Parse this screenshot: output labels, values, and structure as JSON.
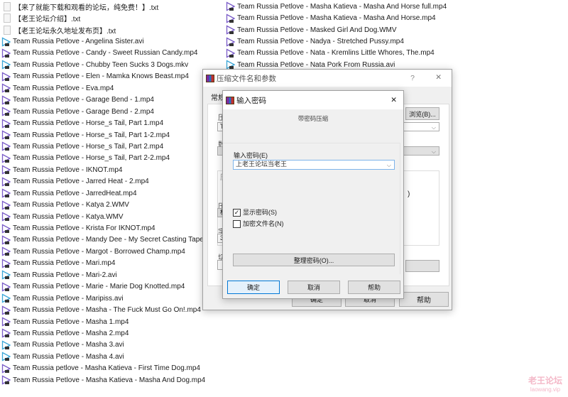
{
  "files_left": [
    {
      "name": "【来了就能下载和观看的论坛，纯免费！】.txt",
      "type": "txt"
    },
    {
      "name": "【老王论坛介绍】.txt",
      "type": "txt"
    },
    {
      "name": "【老王论坛永久地址发布页】.txt",
      "type": "txt"
    },
    {
      "name": "Team Russia Petlove - Angelina Sister.avi",
      "type": "avi"
    },
    {
      "name": "Team Russia Petlove - Candy - Sweet Russian Candy.mp4",
      "type": "mp4"
    },
    {
      "name": "Team Russia Petlove - Chubby Teen Sucks 3 Dogs.mkv",
      "type": "avi"
    },
    {
      "name": "Team Russia Petlove - Elen - Mamka Knows Beast.mp4",
      "type": "mp4"
    },
    {
      "name": "Team Russia Petlove - Eva.mp4",
      "type": "mp4"
    },
    {
      "name": "Team Russia Petlove - Garage Bend - 1.mp4",
      "type": "mp4"
    },
    {
      "name": "Team Russia Petlove - Garage Bend - 2.mp4",
      "type": "mp4"
    },
    {
      "name": "Team Russia Petlove - Horse_s Tail, Part 1.mp4",
      "type": "mp4"
    },
    {
      "name": "Team Russia Petlove - Horse_s Tail, Part 1-2.mp4",
      "type": "mp4"
    },
    {
      "name": "Team Russia Petlove - Horse_s Tail, Part 2.mp4",
      "type": "mp4"
    },
    {
      "name": "Team Russia Petlove - Horse_s Tail, Part 2-2.mp4",
      "type": "mp4"
    },
    {
      "name": "Team Russia Petlove - IKNOT.mp4",
      "type": "mp4"
    },
    {
      "name": "Team Russia Petlove - Jarred Heat - 2.mp4",
      "type": "mp4"
    },
    {
      "name": "Team Russia Petlove - JarredHeat.mp4",
      "type": "mp4"
    },
    {
      "name": "Team Russia Petlove - Katya 2.WMV",
      "type": "mp4"
    },
    {
      "name": "Team Russia Petlove - Katya.WMV",
      "type": "mp4"
    },
    {
      "name": "Team Russia Petlove - Krista For IKNOT.mp4",
      "type": "mp4"
    },
    {
      "name": "Team Russia Petlove - Mandy Dee - My Secret Casting Tape",
      "type": "mp4"
    },
    {
      "name": "Team Russia Petlove - Margot - Borrowed Champ.mp4",
      "type": "mp4"
    },
    {
      "name": "Team Russia Petlove - Mari.mp4",
      "type": "mp4"
    },
    {
      "name": "Team Russia Petlove - Mari-2.avi",
      "type": "avi"
    },
    {
      "name": "Team Russia Petlove - Marie - Marie Dog Knotted.mp4",
      "type": "mp4"
    },
    {
      "name": "Team Russia Petlove - Maripiss.avi",
      "type": "avi"
    },
    {
      "name": "Team Russia Petlove - Masha - The Fuck Must Go On!.mp4",
      "type": "mp4"
    },
    {
      "name": "Team Russia Petlove - Masha 1.mp4",
      "type": "mp4"
    },
    {
      "name": "Team Russia Petlove - Masha 2.mp4",
      "type": "mp4"
    },
    {
      "name": "Team Russia Petlove - Masha 3.avi",
      "type": "avi"
    },
    {
      "name": "Team Russia Petlove - Masha 4.avi",
      "type": "avi"
    },
    {
      "name": "Team Russia petlove - Masha Katieva - First Time Dog.mp4",
      "type": "mp4"
    },
    {
      "name": "Team Russia Petlove - Masha Katieva - Masha And Dog.mp4",
      "type": "mp4"
    }
  ],
  "files_right": [
    {
      "name": "Team Russia Petlove - Masha Katieva - Masha And Horse full.mp4",
      "type": "mp4"
    },
    {
      "name": "Team Russia Petlove - Masha Katieva - Masha And Horse.mp4",
      "type": "mp4"
    },
    {
      "name": "Team Russia Petlove - Masked Girl And Dog.WMV",
      "type": "mp4"
    },
    {
      "name": "Team Russia Petlove - Nadya - Stretched Pussy.mp4",
      "type": "mp4"
    },
    {
      "name": "Team Russia Petlove - Nata - Kremlins Little Whores, The.mp4",
      "type": "mp4"
    },
    {
      "name": "Team Russia Petlove - Nata Pork From Russia.avi",
      "type": "avi"
    }
  ],
  "colors": {
    "avi": "#3aa6d8",
    "mp4": "#7a5cc8"
  },
  "archive_dialog": {
    "title": "压缩文件名和参数",
    "help_glyph": "?",
    "close_glyph": "✕",
    "tab": "常规",
    "frag_label1": "压",
    "frag_field1": "Te",
    "frag_label2": "数",
    "frag_group": "压",
    "frag_label3": "压",
    "frag_combo": "标",
    "frag_label4": "字",
    "frag_field2": "32",
    "frag_label5": "切",
    "frag_paren": ")",
    "browse": "浏览(B)...",
    "ok": "确定",
    "cancel": "取消",
    "help": "帮助"
  },
  "password_dialog": {
    "title": "输入密码",
    "close_glyph": "✕",
    "heading": "带密码压缩",
    "password_label": "输入密码(E)",
    "password_value": "上老王论坛当老王",
    "show_password": "显示密码(S)",
    "show_password_checked": true,
    "encrypt_names": "加密文件名(N)",
    "encrypt_names_checked": false,
    "organize": "整理密码(O)...",
    "ok": "确定",
    "cancel": "取消",
    "help": "帮助"
  },
  "watermark": {
    "line1": "老王论坛",
    "line2": "laowang.vip"
  }
}
